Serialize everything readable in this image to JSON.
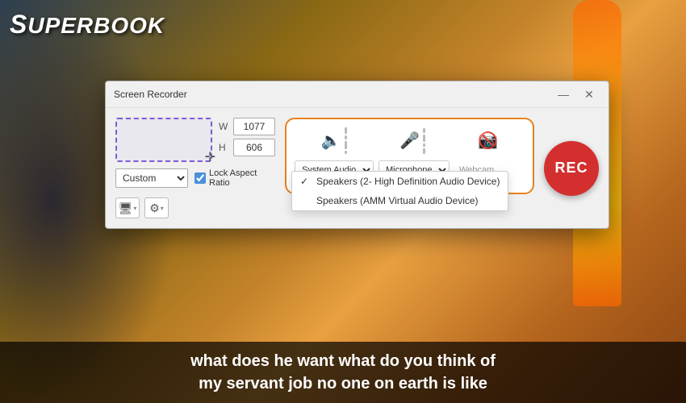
{
  "logo": {
    "text": "SUPERBOOK"
  },
  "subtitle": {
    "line1": "what does he want what do you think of",
    "line2": "my servant job no one on earth is like"
  },
  "dialog": {
    "title": "Screen Recorder",
    "minimize_label": "—",
    "close_label": "✕",
    "width_label": "W",
    "height_label": "H",
    "width_value": "1077",
    "height_value": "606",
    "preset_value": "Custom",
    "lock_label": "Lock Aspect",
    "lock_label2": "Ratio",
    "system_audio_label": "System Audio",
    "microphone_label": "Microphone",
    "webcam_label": "Webcam",
    "rec_label": "REC",
    "dropdown_items": [
      {
        "checked": true,
        "label": "Speakers (2- High Definition Audio Device)"
      },
      {
        "checked": false,
        "label": "Speakers (AMM Virtual Audio Device)"
      }
    ]
  }
}
